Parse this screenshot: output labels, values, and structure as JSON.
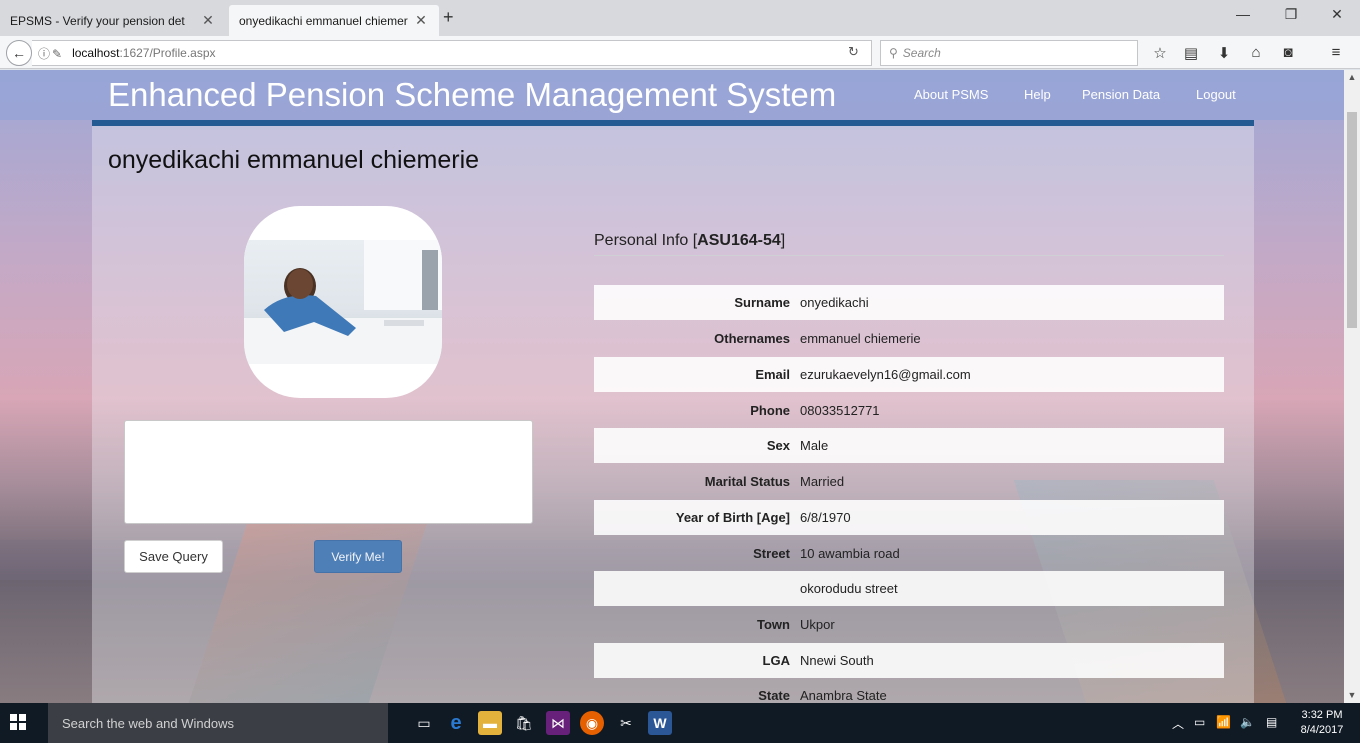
{
  "browser": {
    "tabs": [
      {
        "title": "EPSMS - Verify your pension det",
        "active": false
      },
      {
        "title": "onyedikachi emmanuel chiemer",
        "active": true
      }
    ],
    "url_host": "localhost",
    "url_path": ":1627/Profile.aspx",
    "search_placeholder": "Search"
  },
  "header": {
    "title": "Enhanced Pension Scheme Management System",
    "nav": [
      "About PSMS",
      "Help",
      "Pension Data",
      "Logout"
    ]
  },
  "profile": {
    "name": "onyedikachi emmanuel chiemerie",
    "personal_info_label": "Personal Info [",
    "personal_info_id": "ASU164-54",
    "personal_info_close": "]",
    "fields": [
      {
        "label": "Surname",
        "value": "onyedikachi"
      },
      {
        "label": "Othernames",
        "value": "emmanuel chiemerie"
      },
      {
        "label": "Email",
        "value": "ezurukaevelyn16@gmail.com"
      },
      {
        "label": "Phone",
        "value": "08033512771"
      },
      {
        "label": "Sex",
        "value": "Male"
      },
      {
        "label": "Marital Status",
        "value": "Married"
      },
      {
        "label": "Year of Birth [Age]",
        "value": "6/8/1970"
      },
      {
        "label": "Street",
        "value": "10 awambia road"
      },
      {
        "label": "",
        "value": "okorodudu street"
      },
      {
        "label": "Town",
        "value": "Ukpor"
      },
      {
        "label": "LGA",
        "value": "Nnewi South"
      },
      {
        "label": "State",
        "value": "Anambra State"
      }
    ],
    "save_button": "Save Query",
    "verify_button": "Verify Me!",
    "query_text": ""
  },
  "taskbar": {
    "search_text": "Search the web and Windows",
    "time": "3:32 PM",
    "date": "8/4/2017"
  },
  "colors": {
    "header_accent": "#235a92",
    "verify_button": "#4f7fb7"
  }
}
